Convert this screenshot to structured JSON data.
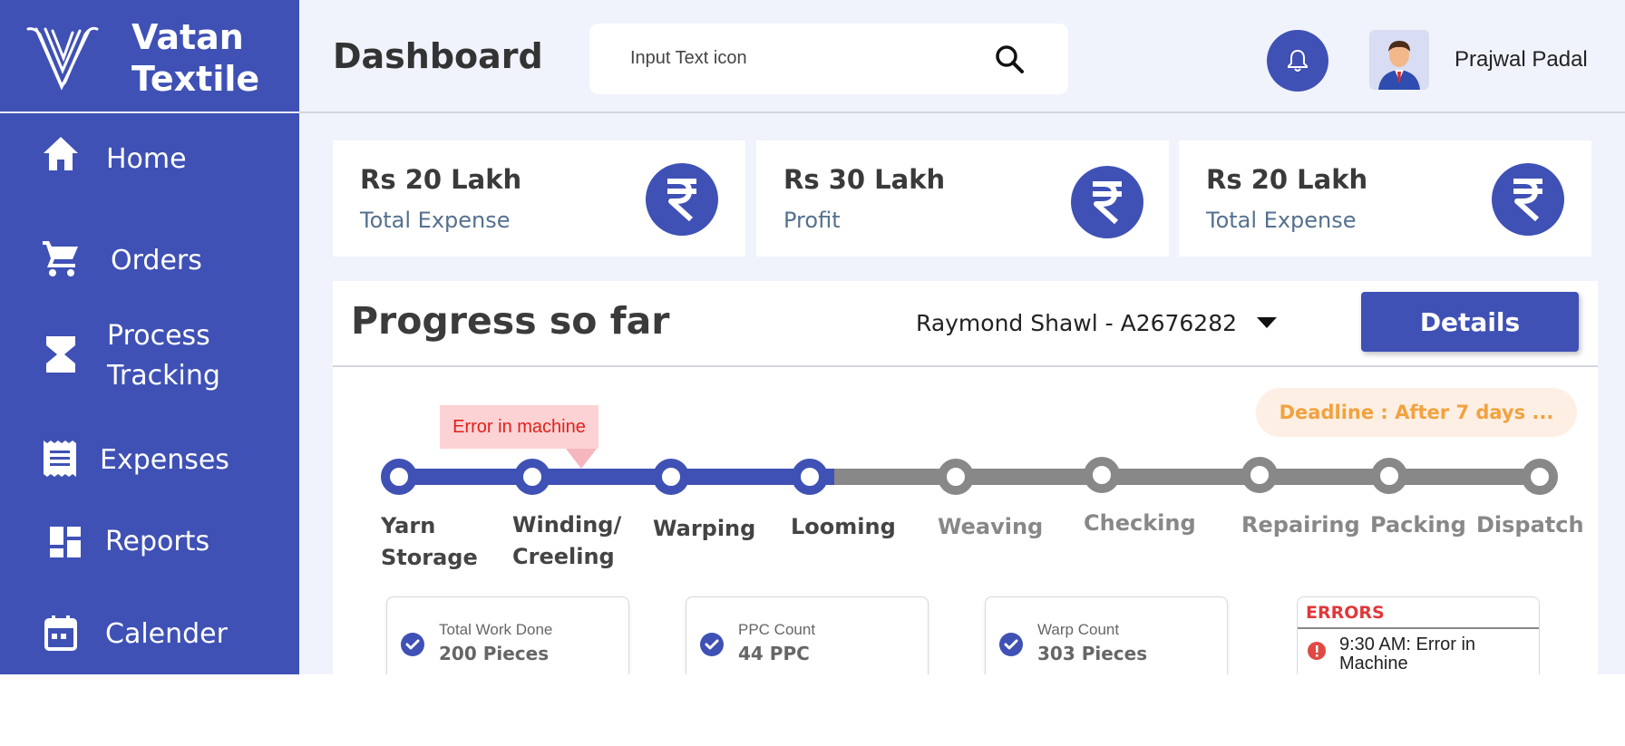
{
  "brand": {
    "name_line1": "Vatan",
    "name_line2": "Textile"
  },
  "sidebar": {
    "items": [
      {
        "label": "Home",
        "icon": "home-icon"
      },
      {
        "label": "Orders",
        "icon": "cart-icon"
      },
      {
        "label_line1": "Process",
        "label_line2": "Tracking",
        "icon": "hourglass-icon"
      },
      {
        "label": "Expenses",
        "icon": "receipt-icon"
      },
      {
        "label": "Reports",
        "icon": "dashboard-grid-icon"
      },
      {
        "label": "Calender",
        "icon": "calendar-icon"
      }
    ]
  },
  "header": {
    "title": "Dashboard",
    "search_placeholder": "Input Text icon",
    "user_name": "Prajwal Padal"
  },
  "stats": [
    {
      "amount": "Rs 20 Lakh",
      "label": "Total Expense",
      "icon": "rupee-icon"
    },
    {
      "amount": "Rs 30 Lakh",
      "label": "Profit",
      "icon": "rupee-icon"
    },
    {
      "amount": "Rs 20 Lakh",
      "label": "Total Expense",
      "icon": "rupee-icon"
    }
  ],
  "progress": {
    "title": "Progress so far",
    "selected_product": "Raymond Shawl - A2676282",
    "details_label": "Details",
    "deadline": "Deadline : After 7 days ...",
    "error_tooltip": "Error in machine",
    "stages": [
      {
        "line1": "Yarn",
        "line2": "Storage",
        "done": true
      },
      {
        "line1": "Winding/",
        "line2": "Creeling",
        "done": true
      },
      {
        "line1": "Warping",
        "line2": "",
        "done": true
      },
      {
        "line1": "Looming",
        "line2": "",
        "done": true
      },
      {
        "line1": "Weaving",
        "line2": "",
        "done": false
      },
      {
        "line1": "Checking",
        "line2": "",
        "done": false
      },
      {
        "line1": "Repairing",
        "line2": "",
        "done": false
      },
      {
        "line1": "Packing",
        "line2": "",
        "done": false
      },
      {
        "line1": "Dispatch",
        "line2": "",
        "done": false
      }
    ]
  },
  "info_cards": [
    {
      "label": "Total Work Done",
      "value": "200 Pieces"
    },
    {
      "label": "PPC Count",
      "value": "44 PPC"
    },
    {
      "label": "Warp Count",
      "value": "303 Pieces"
    }
  ],
  "errors": {
    "title": "ERRORS",
    "item": "9:30 AM: Error in Machine"
  },
  "colors": {
    "primary": "#3f51b5",
    "pending": "#888888",
    "deadline_text": "#f2a23f",
    "error": "#e0211b"
  }
}
